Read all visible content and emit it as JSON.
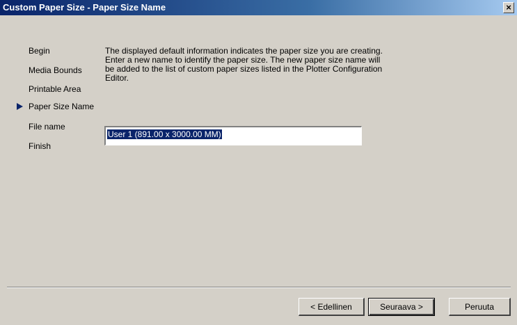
{
  "window": {
    "title": "Custom Paper Size - Paper Size Name",
    "close_glyph": "×"
  },
  "steps": [
    {
      "label": "Begin",
      "current": false
    },
    {
      "label": "Media Bounds",
      "current": false
    },
    {
      "label": "Printable Area",
      "current": false
    },
    {
      "label": "Paper Size Name",
      "current": true
    },
    {
      "label": "File name",
      "current": false
    },
    {
      "label": "Finish",
      "current": false
    }
  ],
  "main": {
    "description": "The displayed default information indicates the paper size you are creating. Enter a new name to identify the paper size. The new paper size name will be added to the list of custom paper sizes listed in the Plotter Configuration Editor.",
    "paper_size_name_value": "User 1 (891.00 x 3000.00 MM)"
  },
  "buttons": {
    "back": "< Edellinen",
    "next": "Seuraava >",
    "cancel": "Peruuta"
  },
  "colors": {
    "title_bar": "#0a246a",
    "selection": "#0a246a",
    "window_bg": "#d4d0c8"
  }
}
